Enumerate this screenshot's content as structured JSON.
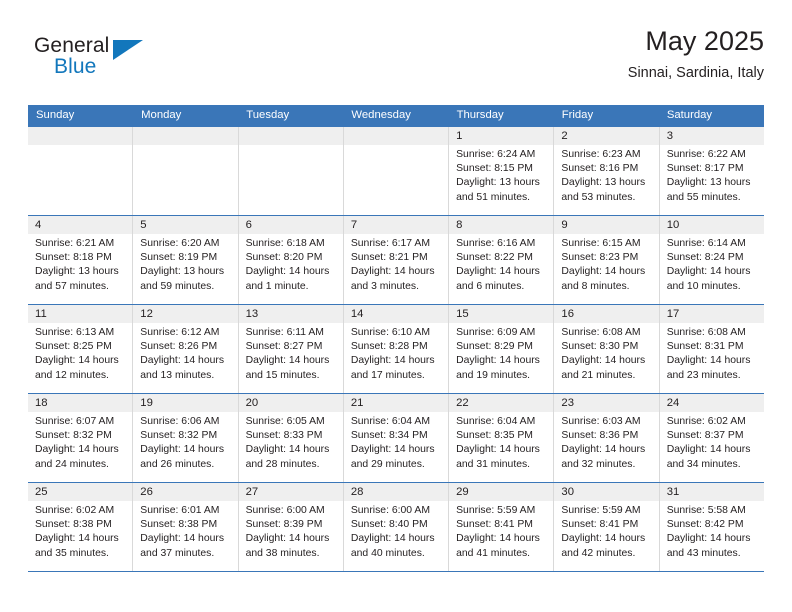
{
  "brand": {
    "name_part1": "General",
    "name_part2": "Blue",
    "logo_icon": "triangle-logo-icon"
  },
  "header": {
    "title": "May 2025",
    "subtitle": "Sinnai, Sardinia, Italy"
  },
  "colors": {
    "header_blue": "#3a76b8",
    "brand_blue": "#1277bc",
    "daynum_band": "#efefef",
    "cell_border": "#d9d9d9",
    "text": "#231f20"
  },
  "weekdays": [
    "Sunday",
    "Monday",
    "Tuesday",
    "Wednesday",
    "Thursday",
    "Friday",
    "Saturday"
  ],
  "labels": {
    "sunrise_prefix": "Sunrise:",
    "sunset_prefix": "Sunset:",
    "daylight_prefix": "Daylight:"
  },
  "weeks": [
    [
      {
        "day": "",
        "empty": true,
        "sunrise": "",
        "sunset": "",
        "daylight_line1": "",
        "daylight_line2": ""
      },
      {
        "day": "",
        "empty": true,
        "sunrise": "",
        "sunset": "",
        "daylight_line1": "",
        "daylight_line2": ""
      },
      {
        "day": "",
        "empty": true,
        "sunrise": "",
        "sunset": "",
        "daylight_line1": "",
        "daylight_line2": ""
      },
      {
        "day": "",
        "empty": true,
        "sunrise": "",
        "sunset": "",
        "daylight_line1": "",
        "daylight_line2": ""
      },
      {
        "day": "1",
        "empty": false,
        "sunrise": "Sunrise: 6:24 AM",
        "sunset": "Sunset: 8:15 PM",
        "daylight_line1": "Daylight: 13 hours",
        "daylight_line2": "and 51 minutes."
      },
      {
        "day": "2",
        "empty": false,
        "sunrise": "Sunrise: 6:23 AM",
        "sunset": "Sunset: 8:16 PM",
        "daylight_line1": "Daylight: 13 hours",
        "daylight_line2": "and 53 minutes."
      },
      {
        "day": "3",
        "empty": false,
        "sunrise": "Sunrise: 6:22 AM",
        "sunset": "Sunset: 8:17 PM",
        "daylight_line1": "Daylight: 13 hours",
        "daylight_line2": "and 55 minutes."
      }
    ],
    [
      {
        "day": "4",
        "empty": false,
        "sunrise": "Sunrise: 6:21 AM",
        "sunset": "Sunset: 8:18 PM",
        "daylight_line1": "Daylight: 13 hours",
        "daylight_line2": "and 57 minutes."
      },
      {
        "day": "5",
        "empty": false,
        "sunrise": "Sunrise: 6:20 AM",
        "sunset": "Sunset: 8:19 PM",
        "daylight_line1": "Daylight: 13 hours",
        "daylight_line2": "and 59 minutes."
      },
      {
        "day": "6",
        "empty": false,
        "sunrise": "Sunrise: 6:18 AM",
        "sunset": "Sunset: 8:20 PM",
        "daylight_line1": "Daylight: 14 hours",
        "daylight_line2": "and 1 minute."
      },
      {
        "day": "7",
        "empty": false,
        "sunrise": "Sunrise: 6:17 AM",
        "sunset": "Sunset: 8:21 PM",
        "daylight_line1": "Daylight: 14 hours",
        "daylight_line2": "and 3 minutes."
      },
      {
        "day": "8",
        "empty": false,
        "sunrise": "Sunrise: 6:16 AM",
        "sunset": "Sunset: 8:22 PM",
        "daylight_line1": "Daylight: 14 hours",
        "daylight_line2": "and 6 minutes."
      },
      {
        "day": "9",
        "empty": false,
        "sunrise": "Sunrise: 6:15 AM",
        "sunset": "Sunset: 8:23 PM",
        "daylight_line1": "Daylight: 14 hours",
        "daylight_line2": "and 8 minutes."
      },
      {
        "day": "10",
        "empty": false,
        "sunrise": "Sunrise: 6:14 AM",
        "sunset": "Sunset: 8:24 PM",
        "daylight_line1": "Daylight: 14 hours",
        "daylight_line2": "and 10 minutes."
      }
    ],
    [
      {
        "day": "11",
        "empty": false,
        "sunrise": "Sunrise: 6:13 AM",
        "sunset": "Sunset: 8:25 PM",
        "daylight_line1": "Daylight: 14 hours",
        "daylight_line2": "and 12 minutes."
      },
      {
        "day": "12",
        "empty": false,
        "sunrise": "Sunrise: 6:12 AM",
        "sunset": "Sunset: 8:26 PM",
        "daylight_line1": "Daylight: 14 hours",
        "daylight_line2": "and 13 minutes."
      },
      {
        "day": "13",
        "empty": false,
        "sunrise": "Sunrise: 6:11 AM",
        "sunset": "Sunset: 8:27 PM",
        "daylight_line1": "Daylight: 14 hours",
        "daylight_line2": "and 15 minutes."
      },
      {
        "day": "14",
        "empty": false,
        "sunrise": "Sunrise: 6:10 AM",
        "sunset": "Sunset: 8:28 PM",
        "daylight_line1": "Daylight: 14 hours",
        "daylight_line2": "and 17 minutes."
      },
      {
        "day": "15",
        "empty": false,
        "sunrise": "Sunrise: 6:09 AM",
        "sunset": "Sunset: 8:29 PM",
        "daylight_line1": "Daylight: 14 hours",
        "daylight_line2": "and 19 minutes."
      },
      {
        "day": "16",
        "empty": false,
        "sunrise": "Sunrise: 6:08 AM",
        "sunset": "Sunset: 8:30 PM",
        "daylight_line1": "Daylight: 14 hours",
        "daylight_line2": "and 21 minutes."
      },
      {
        "day": "17",
        "empty": false,
        "sunrise": "Sunrise: 6:08 AM",
        "sunset": "Sunset: 8:31 PM",
        "daylight_line1": "Daylight: 14 hours",
        "daylight_line2": "and 23 minutes."
      }
    ],
    [
      {
        "day": "18",
        "empty": false,
        "sunrise": "Sunrise: 6:07 AM",
        "sunset": "Sunset: 8:32 PM",
        "daylight_line1": "Daylight: 14 hours",
        "daylight_line2": "and 24 minutes."
      },
      {
        "day": "19",
        "empty": false,
        "sunrise": "Sunrise: 6:06 AM",
        "sunset": "Sunset: 8:32 PM",
        "daylight_line1": "Daylight: 14 hours",
        "daylight_line2": "and 26 minutes."
      },
      {
        "day": "20",
        "empty": false,
        "sunrise": "Sunrise: 6:05 AM",
        "sunset": "Sunset: 8:33 PM",
        "daylight_line1": "Daylight: 14 hours",
        "daylight_line2": "and 28 minutes."
      },
      {
        "day": "21",
        "empty": false,
        "sunrise": "Sunrise: 6:04 AM",
        "sunset": "Sunset: 8:34 PM",
        "daylight_line1": "Daylight: 14 hours",
        "daylight_line2": "and 29 minutes."
      },
      {
        "day": "22",
        "empty": false,
        "sunrise": "Sunrise: 6:04 AM",
        "sunset": "Sunset: 8:35 PM",
        "daylight_line1": "Daylight: 14 hours",
        "daylight_line2": "and 31 minutes."
      },
      {
        "day": "23",
        "empty": false,
        "sunrise": "Sunrise: 6:03 AM",
        "sunset": "Sunset: 8:36 PM",
        "daylight_line1": "Daylight: 14 hours",
        "daylight_line2": "and 32 minutes."
      },
      {
        "day": "24",
        "empty": false,
        "sunrise": "Sunrise: 6:02 AM",
        "sunset": "Sunset: 8:37 PM",
        "daylight_line1": "Daylight: 14 hours",
        "daylight_line2": "and 34 minutes."
      }
    ],
    [
      {
        "day": "25",
        "empty": false,
        "sunrise": "Sunrise: 6:02 AM",
        "sunset": "Sunset: 8:38 PM",
        "daylight_line1": "Daylight: 14 hours",
        "daylight_line2": "and 35 minutes."
      },
      {
        "day": "26",
        "empty": false,
        "sunrise": "Sunrise: 6:01 AM",
        "sunset": "Sunset: 8:38 PM",
        "daylight_line1": "Daylight: 14 hours",
        "daylight_line2": "and 37 minutes."
      },
      {
        "day": "27",
        "empty": false,
        "sunrise": "Sunrise: 6:00 AM",
        "sunset": "Sunset: 8:39 PM",
        "daylight_line1": "Daylight: 14 hours",
        "daylight_line2": "and 38 minutes."
      },
      {
        "day": "28",
        "empty": false,
        "sunrise": "Sunrise: 6:00 AM",
        "sunset": "Sunset: 8:40 PM",
        "daylight_line1": "Daylight: 14 hours",
        "daylight_line2": "and 40 minutes."
      },
      {
        "day": "29",
        "empty": false,
        "sunrise": "Sunrise: 5:59 AM",
        "sunset": "Sunset: 8:41 PM",
        "daylight_line1": "Daylight: 14 hours",
        "daylight_line2": "and 41 minutes."
      },
      {
        "day": "30",
        "empty": false,
        "sunrise": "Sunrise: 5:59 AM",
        "sunset": "Sunset: 8:41 PM",
        "daylight_line1": "Daylight: 14 hours",
        "daylight_line2": "and 42 minutes."
      },
      {
        "day": "31",
        "empty": false,
        "sunrise": "Sunrise: 5:58 AM",
        "sunset": "Sunset: 8:42 PM",
        "daylight_line1": "Daylight: 14 hours",
        "daylight_line2": "and 43 minutes."
      }
    ]
  ]
}
